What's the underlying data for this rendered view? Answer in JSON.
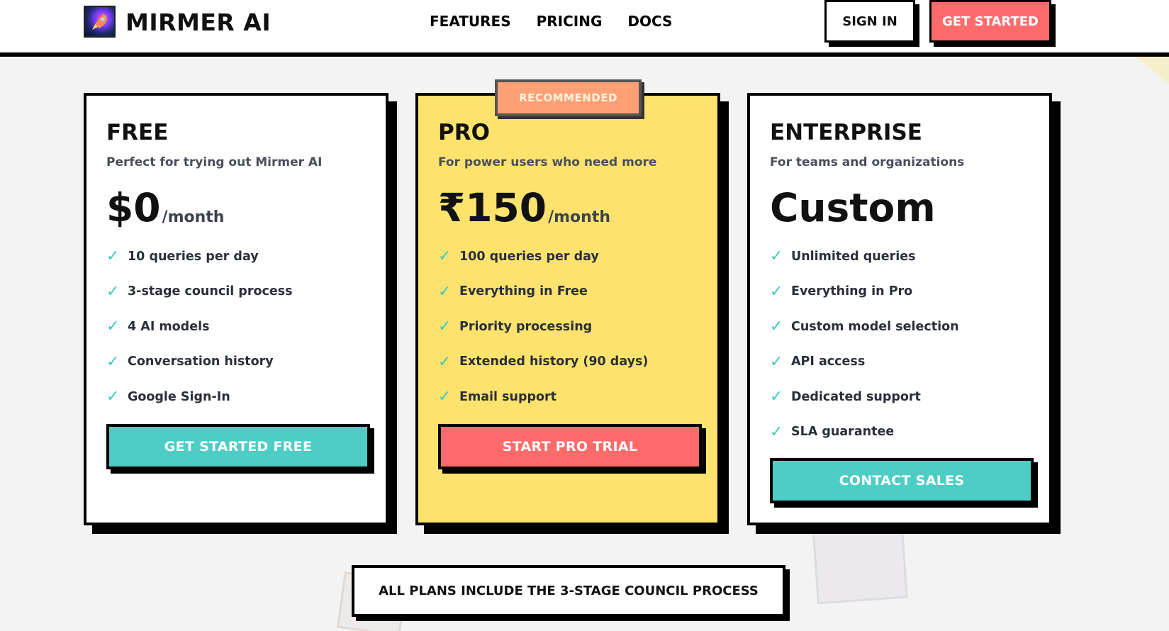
{
  "header": {
    "brand": "MIRMER AI",
    "nav": [
      "FEATURES",
      "PRICING",
      "DOCS"
    ],
    "sign_in": "SIGN IN",
    "get_started": "GET STARTED"
  },
  "badge": "RECOMMENDED",
  "plans": [
    {
      "name": "FREE",
      "description": "Perfect for trying out Mirmer AI",
      "price": "$0",
      "period": "/month",
      "features": [
        "10 queries per day",
        "3-stage council process",
        "4 AI models",
        "Conversation history",
        "Google Sign-In"
      ],
      "cta": "GET STARTED FREE"
    },
    {
      "name": "PRO",
      "description": "For power users who need more",
      "price": "₹150",
      "period": "/month",
      "features": [
        "100 queries per day",
        "Everything in Free",
        "Priority processing",
        "Extended history (90 days)",
        "Email support"
      ],
      "cta": "START PRO TRIAL"
    },
    {
      "name": "ENTERPRISE",
      "description": "For teams and organizations",
      "price": "Custom",
      "period": "",
      "features": [
        "Unlimited queries",
        "Everything in Pro",
        "Custom model selection",
        "API access",
        "Dedicated support",
        "SLA guarantee"
      ],
      "cta": "CONTACT SALES"
    }
  ],
  "check_glyph": "✓",
  "footer_banner": "ALL PLANS INCLUDE THE 3-STAGE COUNCIL PROCESS",
  "colors": {
    "accent_red": "#ff6b6b",
    "accent_teal": "#4ecdc4",
    "pro_card": "#fde36d",
    "badge": "#ff9f75"
  }
}
